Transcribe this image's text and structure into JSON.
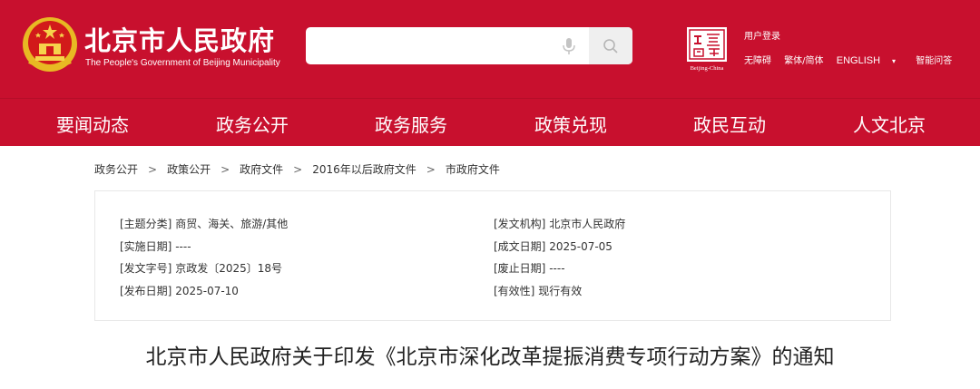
{
  "colors": {
    "brand_red": "#c8102e",
    "search_btn_bg": "#efefef",
    "text_dark": "#333333"
  },
  "header": {
    "title": "北京市人民政府",
    "subtitle": "The People's Government of Beijing Municipality",
    "search": {
      "placeholder": ""
    },
    "capital_logo_text": "Beijing-China",
    "login": "用户登录",
    "links": {
      "accessible": "无障碍",
      "trad_simp": "繁体/简体",
      "english": "ENGLISH",
      "english_arrow": "▾",
      "smart_qa": "智能问答"
    }
  },
  "nav": [
    "要闻动态",
    "政务公开",
    "政务服务",
    "政策兑现",
    "政民互动",
    "人文北京"
  ],
  "breadcrumb": [
    "政务公开",
    "政策公开",
    "政府文件",
    "2016年以后政府文件",
    "市政府文件"
  ],
  "breadcrumb_sep": ">",
  "info": {
    "topic": {
      "label": "[主题分类]",
      "value": "商贸、海关、旅游/其他"
    },
    "issuer": {
      "label": "[发文机构]",
      "value": "北京市人民政府"
    },
    "effective_date": {
      "label": "[实施日期]",
      "value": "----"
    },
    "written_date": {
      "label": "[成文日期]",
      "value": "2025-07-05"
    },
    "doc_number": {
      "label": "[发文字号]",
      "value": "京政发〔2025〕18号"
    },
    "repeal_date": {
      "label": "[废止日期]",
      "value": "----"
    },
    "publish_date": {
      "label": "[发布日期]",
      "value": "2025-07-10"
    },
    "validity": {
      "label": "[有效性]",
      "value": "现行有效"
    }
  },
  "document": {
    "title": "北京市人民政府关于印发《北京市深化改革提振消费专项行动方案》的通知"
  }
}
